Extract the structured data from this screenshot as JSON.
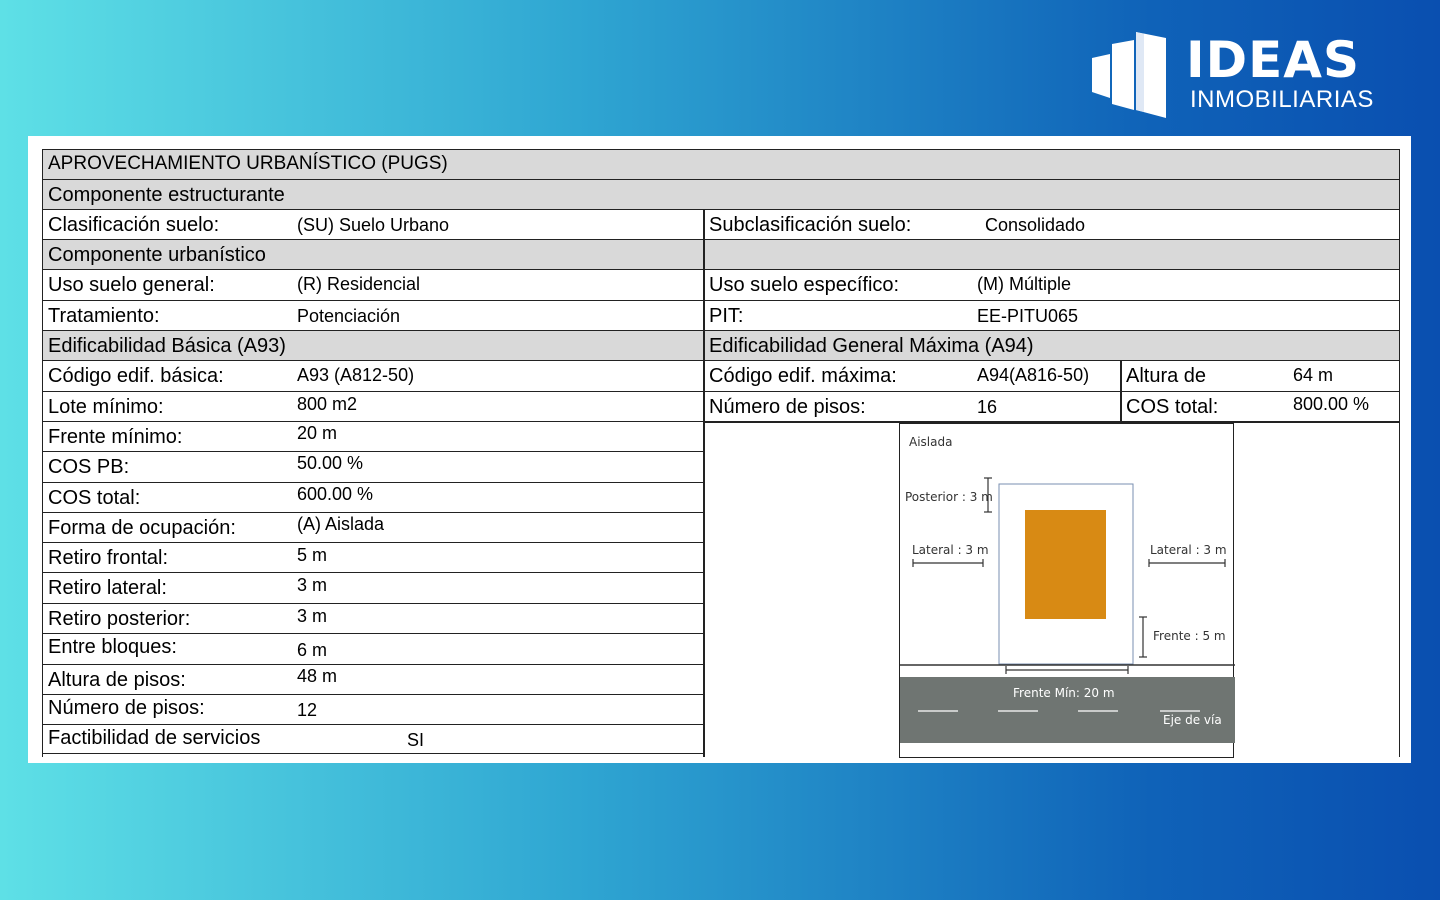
{
  "brand": {
    "name": "IDEAS",
    "tagline": "INMOBILIARIAS"
  },
  "colors": {
    "building": "#d88a14",
    "road": "#6f7572",
    "header_bg": "#d9d9d9"
  },
  "table": {
    "title": "APROVECHAMIENTO URBANÍSTICO (PUGS)",
    "estructurante": "Componente  estructurante",
    "clasificacion_label": "Clasificación suelo:",
    "clasificacion_value": "(SU) Suelo Urbano",
    "subclasificacion_label": "Subclasificación suelo:",
    "subclasificacion_value": "Consolidado",
    "urbanistico": "Componente  urbanístico",
    "uso_general_label": "Uso suelo general:",
    "uso_general_value": "(R) Residencial",
    "uso_especifico_label": "Uso suelo específico:",
    "uso_especifico_value": "(M) Múltiple",
    "tratamiento_label": "Tratamiento:",
    "tratamiento_value": "Potenciación",
    "pit_label": "PIT:",
    "pit_value": "EE-PITU065",
    "basica_header": "Edificabilidad Básica (A93)",
    "maxima_header": "Edificabilidad General Máxima (A94)",
    "basic": [
      {
        "label": "Código edif. básica:",
        "value": "A93 (A812-50)"
      },
      {
        "label": "Lote mínimo:",
        "value": "800 m2"
      },
      {
        "label": "Frente mínimo:",
        "value": "20 m"
      },
      {
        "label": "COS PB:",
        "value": "50.00 %"
      },
      {
        "label": "COS total:",
        "value": "600.00 %"
      },
      {
        "label": "Forma de ocupación:",
        "value": "(A) Aislada"
      },
      {
        "label": "Retiro frontal:",
        "value": "5 m"
      },
      {
        "label": "Retiro lateral:",
        "value": "3 m"
      },
      {
        "label": "Retiro posterior:",
        "value": "3 m"
      },
      {
        "label": "Entre bloques:",
        "value": "6 m"
      },
      {
        "label": "Altura de pisos:",
        "value": "48 m"
      },
      {
        "label": "Número de pisos:",
        "value": "12"
      },
      {
        "label": "Factibilidad de servicios",
        "value": "SI"
      }
    ],
    "codigo_max_label": "Código edif. máxima:",
    "codigo_max_value": "A94(A816-50)",
    "altura_label": "Altura de",
    "altura_value": "64 m",
    "pisos_max_label": "Número de pisos:",
    "pisos_max_value": "16",
    "cos_total_label": "COS total:",
    "cos_total_value": "800.00 %"
  },
  "diagram": {
    "title": "Aislada",
    "posterior": "Posterior : 3 m",
    "lateral_left": "Lateral : 3 m",
    "lateral_right": "Lateral : 3 m",
    "frente": "Frente : 5 m",
    "frente_min": "Frente Mín: 20 m",
    "eje": "Eje de vía"
  }
}
